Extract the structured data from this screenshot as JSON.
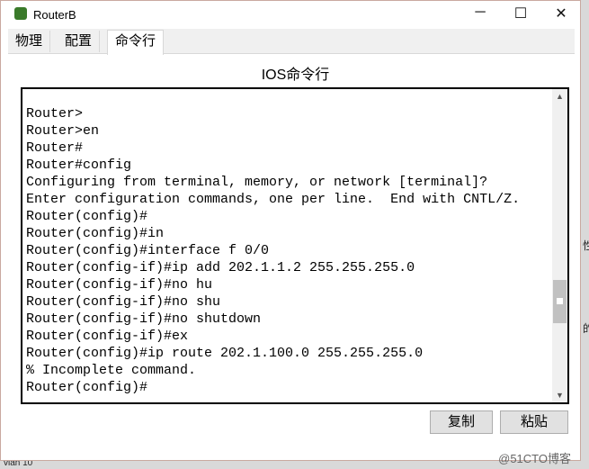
{
  "window": {
    "title": "RouterB",
    "minimize": "─",
    "maximize": "☐",
    "close": "✕"
  },
  "tabs": [
    {
      "label": "物理"
    },
    {
      "label": "配置"
    },
    {
      "label": "命令行",
      "active": true
    }
  ],
  "heading": "IOS命令行",
  "terminal": {
    "lines": [
      "Router>",
      "Router>en",
      "Router#",
      "Router#config",
      "Configuring from terminal, memory, or network [terminal]?",
      "Enter configuration commands, one per line.  End with CNTL/Z.",
      "Router(config)#",
      "Router(config)#in",
      "Router(config)#interface f 0/0",
      "Router(config-if)#ip add 202.1.1.2 255.255.255.0",
      "Router(config-if)#no hu",
      "Router(config-if)#no shu",
      "Router(config-if)#no shutdown",
      "Router(config-if)#ex",
      "Router(config)#ip route 202.1.100.0 255.255.255.0",
      "% Incomplete command.",
      "Router(config)#"
    ],
    "scroll_position_percent": 75
  },
  "buttons": {
    "copy": "复制",
    "paste": "粘贴"
  },
  "watermark": "@51CTO博客",
  "background": {
    "right_top": "性",
    "right_mid": "的",
    "bottom_left": "vlan 10"
  }
}
